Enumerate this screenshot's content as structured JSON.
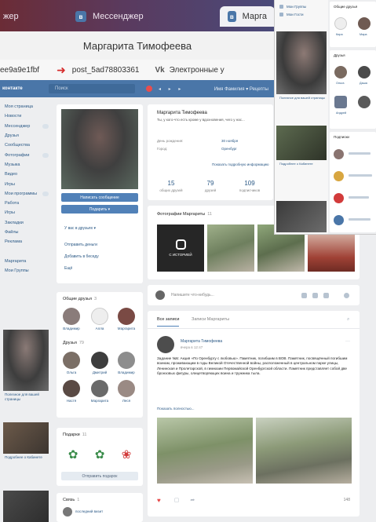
{
  "tabs": [
    {
      "label": "жер"
    },
    {
      "label": "Мессенджер"
    },
    {
      "label": "Марга"
    }
  ],
  "banner_name": "Маргарита Тимофеева",
  "url_row": {
    "left_text": "ee9a9e1fbf",
    "post_text": "post_5ad78803361",
    "vk_label": "Vk",
    "right_text": "Электронные у"
  },
  "vk_header": {
    "logo": "контакте",
    "search_placeholder": "Поиск",
    "user_area": "Имя Фамилия ▾ Рецепты"
  },
  "left_nav": [
    "Моя страница",
    "Новости",
    "Мессенджер",
    "Друзья",
    "Сообщества",
    "Фотографии",
    "Музыка",
    "Видео",
    "Игры",
    "Мои программы",
    "Работа",
    "Игры",
    "Закладки",
    "Файлы",
    "Реклама",
    "Маргарита",
    "Мои Группы"
  ],
  "profile": {
    "write_button": "Написать сообщение",
    "gifts_button": "Подарить ▾",
    "actions": [
      "У вас в друзьях ▾",
      "Отправить деньги",
      "Добавить в беседу",
      "Ещё"
    ]
  },
  "info": {
    "name": "Маргарита Тимофеева",
    "status": "Ты, у кого-что есть кроме у вдохновения, чего у нас...",
    "rows": [
      {
        "label": "День рождения:",
        "value": "30 ноября"
      },
      {
        "label": "Город:",
        "value": "Оренбург"
      }
    ],
    "more_link": "Показать подробную информацию",
    "stats": [
      {
        "n": "15",
        "label": "общих друзей"
      },
      {
        "n": "79",
        "label": "друзей"
      },
      {
        "n": "109",
        "label": "подписчиков"
      }
    ]
  },
  "friends_box": {
    "common_title": "Общие друзья",
    "common_count": "3",
    "common": [
      "Владимир",
      "Алла",
      "Маргарита"
    ],
    "friends_title": "Друзья",
    "friends_count": "79",
    "friends": [
      "Ольга",
      "Дмитрий",
      "Владимир",
      "Настя",
      "Маргарита",
      "Леся"
    ]
  },
  "gifts_box": {
    "title": "Подарки",
    "count": "11",
    "button": "Отправить подарок"
  },
  "video_box": {
    "title": "Связь",
    "count": "1",
    "item": "последний визит"
  },
  "photos_box": {
    "title": "Фотографии Маргариты",
    "count": "11",
    "story_label": "С ИСТОРИЕЙ"
  },
  "composer": {
    "placeholder": "Напишите что-нибудь..."
  },
  "post": {
    "tab_all": "Все записи",
    "tab_own": "Записи Маргариты",
    "author": "Маргарита Тимофеева",
    "date": "вчера в 12:47",
    "text": "Задание №5: Акция «По Оренбургу с любовью». Памятник, погибшим в ВОВ. Памятник, посвящённый погибшим воинам, проживающим в годы Великой Отечественной войны, расположенный в центральном парке улицы, Ленинская и Пролетарской, в гимназии Первомайской Оренбургской области. Памятник представляет собой две бронзовых фигуры, олицетворяющих воина и тружника тыла.",
    "show_more": "Показать полностью...",
    "views": "148"
  },
  "overlay": {
    "menu": [
      "Мои Группы",
      "Мои Гости"
    ],
    "captions": [
      "Полезное для вашей страницы",
      "Подробнее о Кабинете"
    ],
    "right_common_title": "Общие друзья",
    "right_common": [
      "Кира",
      "Мара"
    ],
    "right_friends_title": "Друзья",
    "right_friends": [
      "Ольга",
      "Даша",
      "Андрей"
    ],
    "right_subs_title": "Подписки"
  }
}
